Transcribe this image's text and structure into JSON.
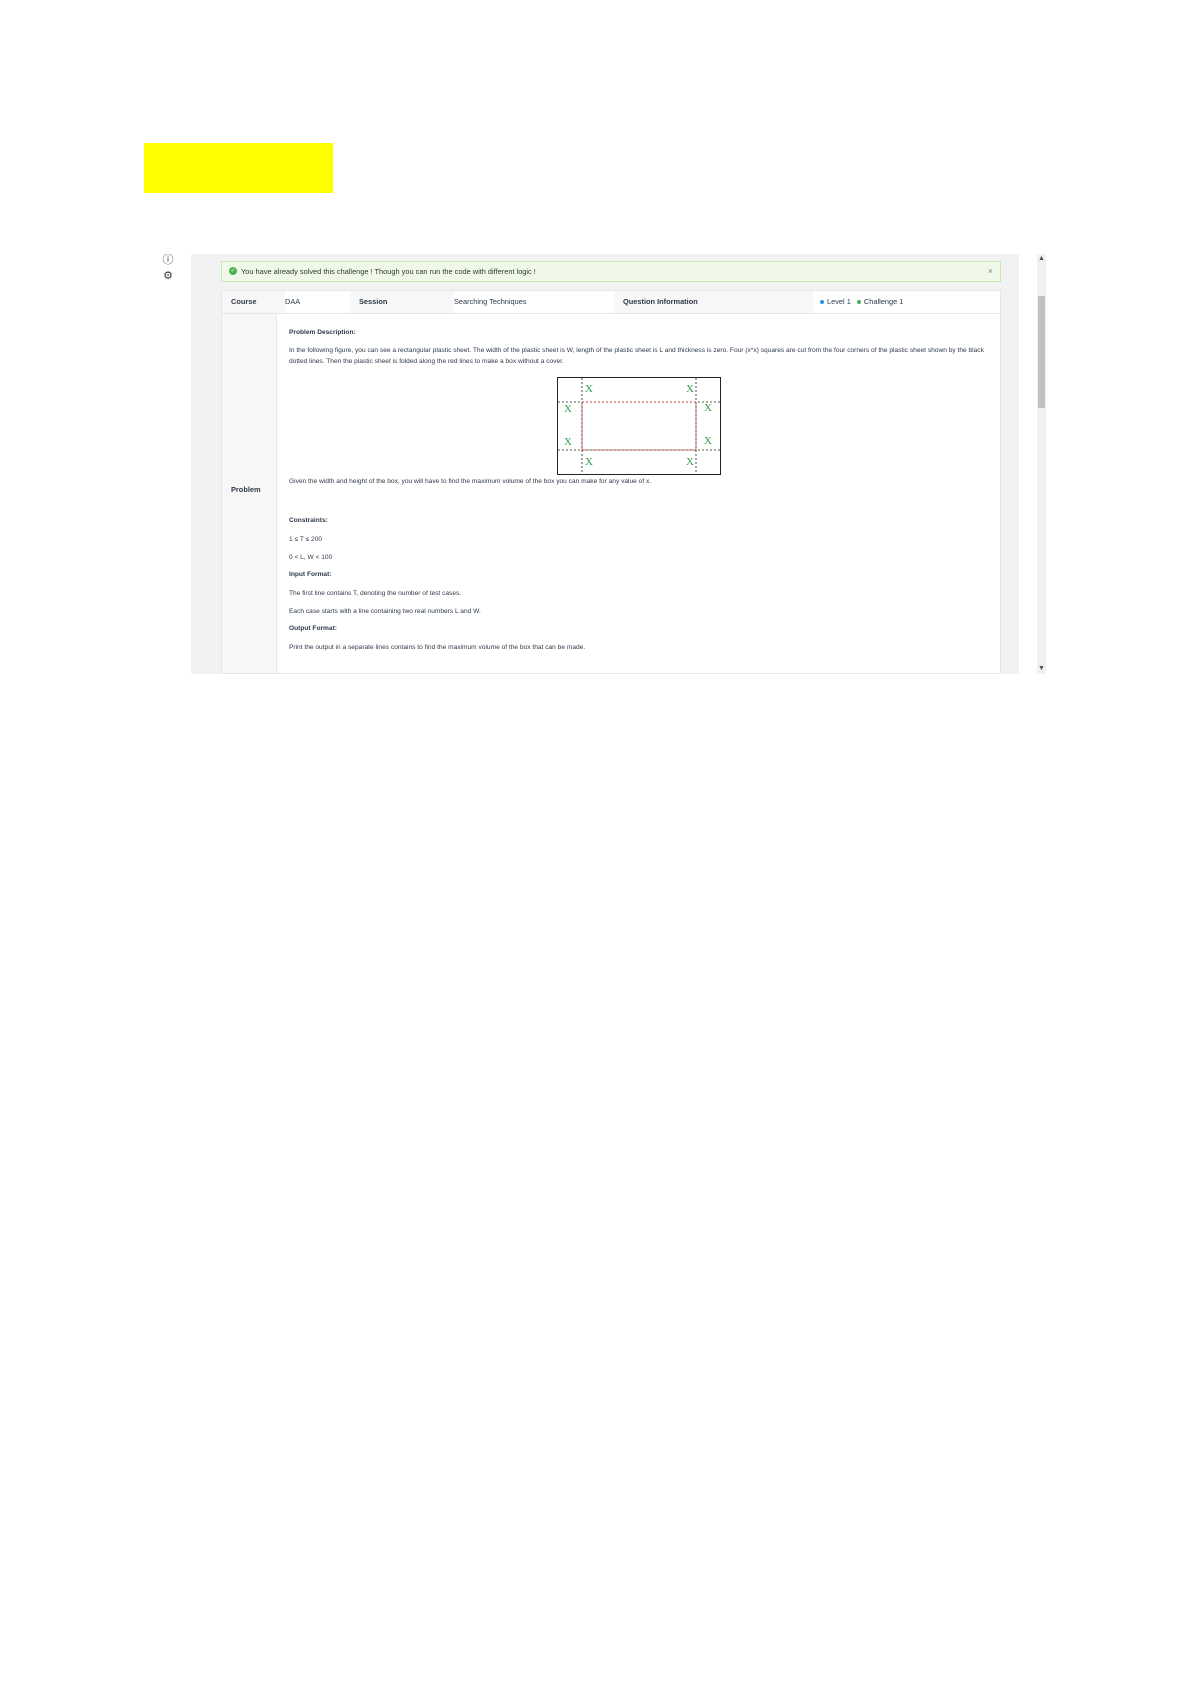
{
  "alert": {
    "message": "You have already solved this challenge ! Though you can run the code with different logic !",
    "close": "×"
  },
  "info": {
    "course_label": "Course",
    "course_value": "DAA",
    "session_label": "Session",
    "session_value": "Searching Techniques",
    "question_label": "Question Information",
    "level": "Level 1",
    "challenge": "Challenge 1"
  },
  "problem": {
    "label": "Problem",
    "description_heading": "Problem Description:",
    "description": "In the following figure, you can see a rectangular plastic sheet. The width of the plastic sheet is W, length of the plastic sheet is L and thickness is zero. Four (x*x) squares are cut from the four corners of the plastic sheet shown by the black dotted lines. Then the plastic sheet is folded along the red lines to make a box without a cover.",
    "figure_mark": "X",
    "after_figure": "Given the width and height of the box, you will have to find the maximum volume of the box you can make for any value of x.",
    "constraints_heading": "Constraints:",
    "constraint_1": "1 ≤ T ≤ 200",
    "constraint_2": "0 < L, W < 100",
    "input_heading": "Input Format:",
    "input_1": "The first line contains T, denoting the number of test cases.",
    "input_2": "Each case starts with a line containing two real numbers L and W.",
    "output_heading": "Output Format:",
    "output_1": "Print the output in a separate lines contains to find the maximum volume of the box that can be made."
  },
  "colors": {
    "highlight": "#ffff00",
    "alert_green": "#4caf50",
    "level_dot": "#2196f3",
    "challenge_dot": "#4caf50",
    "figure_red": "#e53935",
    "figure_green": "#2e9e4f"
  },
  "icons": {
    "rail_1": "info-icon",
    "rail_2": "gear-icon",
    "alert": "check-circle-icon"
  }
}
